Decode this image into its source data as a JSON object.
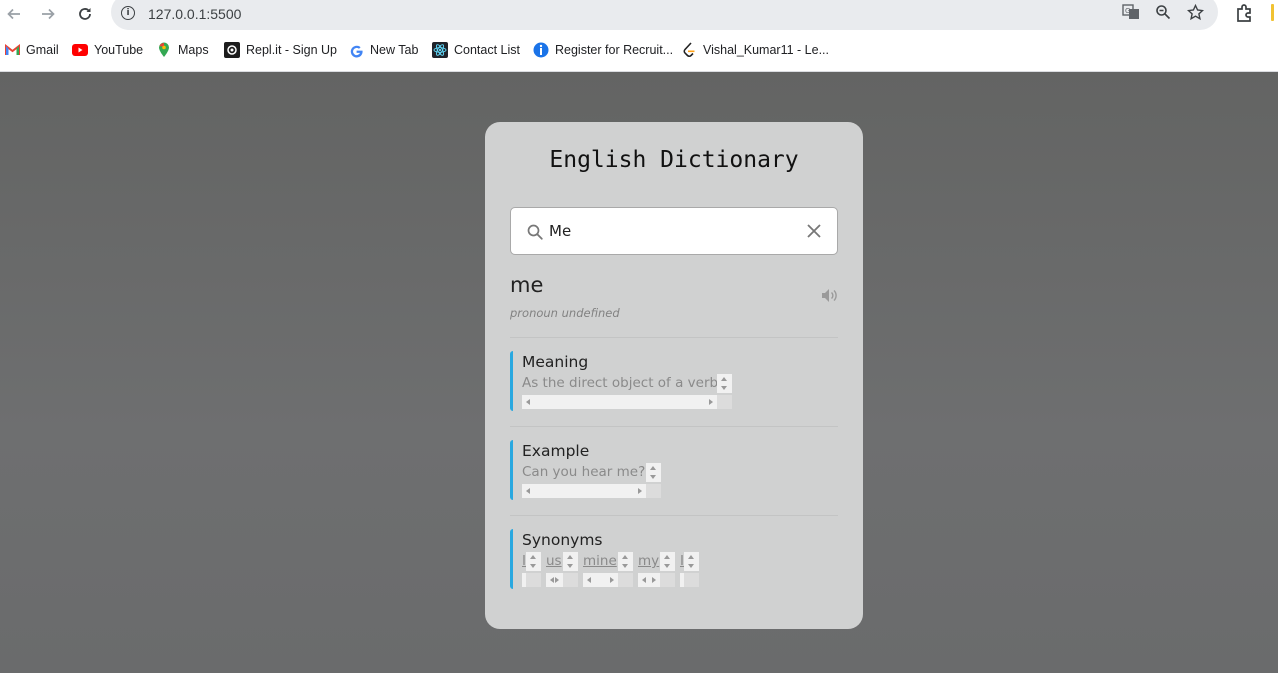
{
  "browser": {
    "url": "127.0.0.1:5500",
    "nav": {
      "back_icon": "arrow-left-icon",
      "forward_icon": "arrow-right-icon",
      "reload_icon": "reload-icon"
    },
    "bookmarks": [
      {
        "label": "Gmail",
        "icon": "gmail-icon"
      },
      {
        "label": "YouTube",
        "icon": "youtube-icon"
      },
      {
        "label": "Maps",
        "icon": "maps-icon"
      },
      {
        "label": "Repl.it - Sign Up",
        "icon": "replit-icon"
      },
      {
        "label": "New Tab",
        "icon": "google-icon"
      },
      {
        "label": "Contact List",
        "icon": "react-icon"
      },
      {
        "label": "Register for Recruit...",
        "icon": "register-icon"
      },
      {
        "label": "Vishal_Kumar11 - Le...",
        "icon": "leetcode-icon"
      }
    ]
  },
  "app": {
    "title": "English Dictionary",
    "search": {
      "value": "Me",
      "icon": "search-icon",
      "clear_icon": "close-icon"
    },
    "result": {
      "word": "me",
      "phonetic": "pronoun undefined",
      "audio_icon": "speaker-icon"
    },
    "sections": {
      "meaning": {
        "title": "Meaning",
        "text": "As the direct object of a verb."
      },
      "example": {
        "title": "Example",
        "text": "Can you hear me?"
      },
      "synonyms": {
        "title": "Synonyms",
        "items": [
          "I",
          "us",
          "mine",
          "my",
          "I"
        ]
      }
    },
    "colors": {
      "accent": "#29a8e0",
      "card": "#d0d1d1",
      "background": "#666767"
    }
  }
}
